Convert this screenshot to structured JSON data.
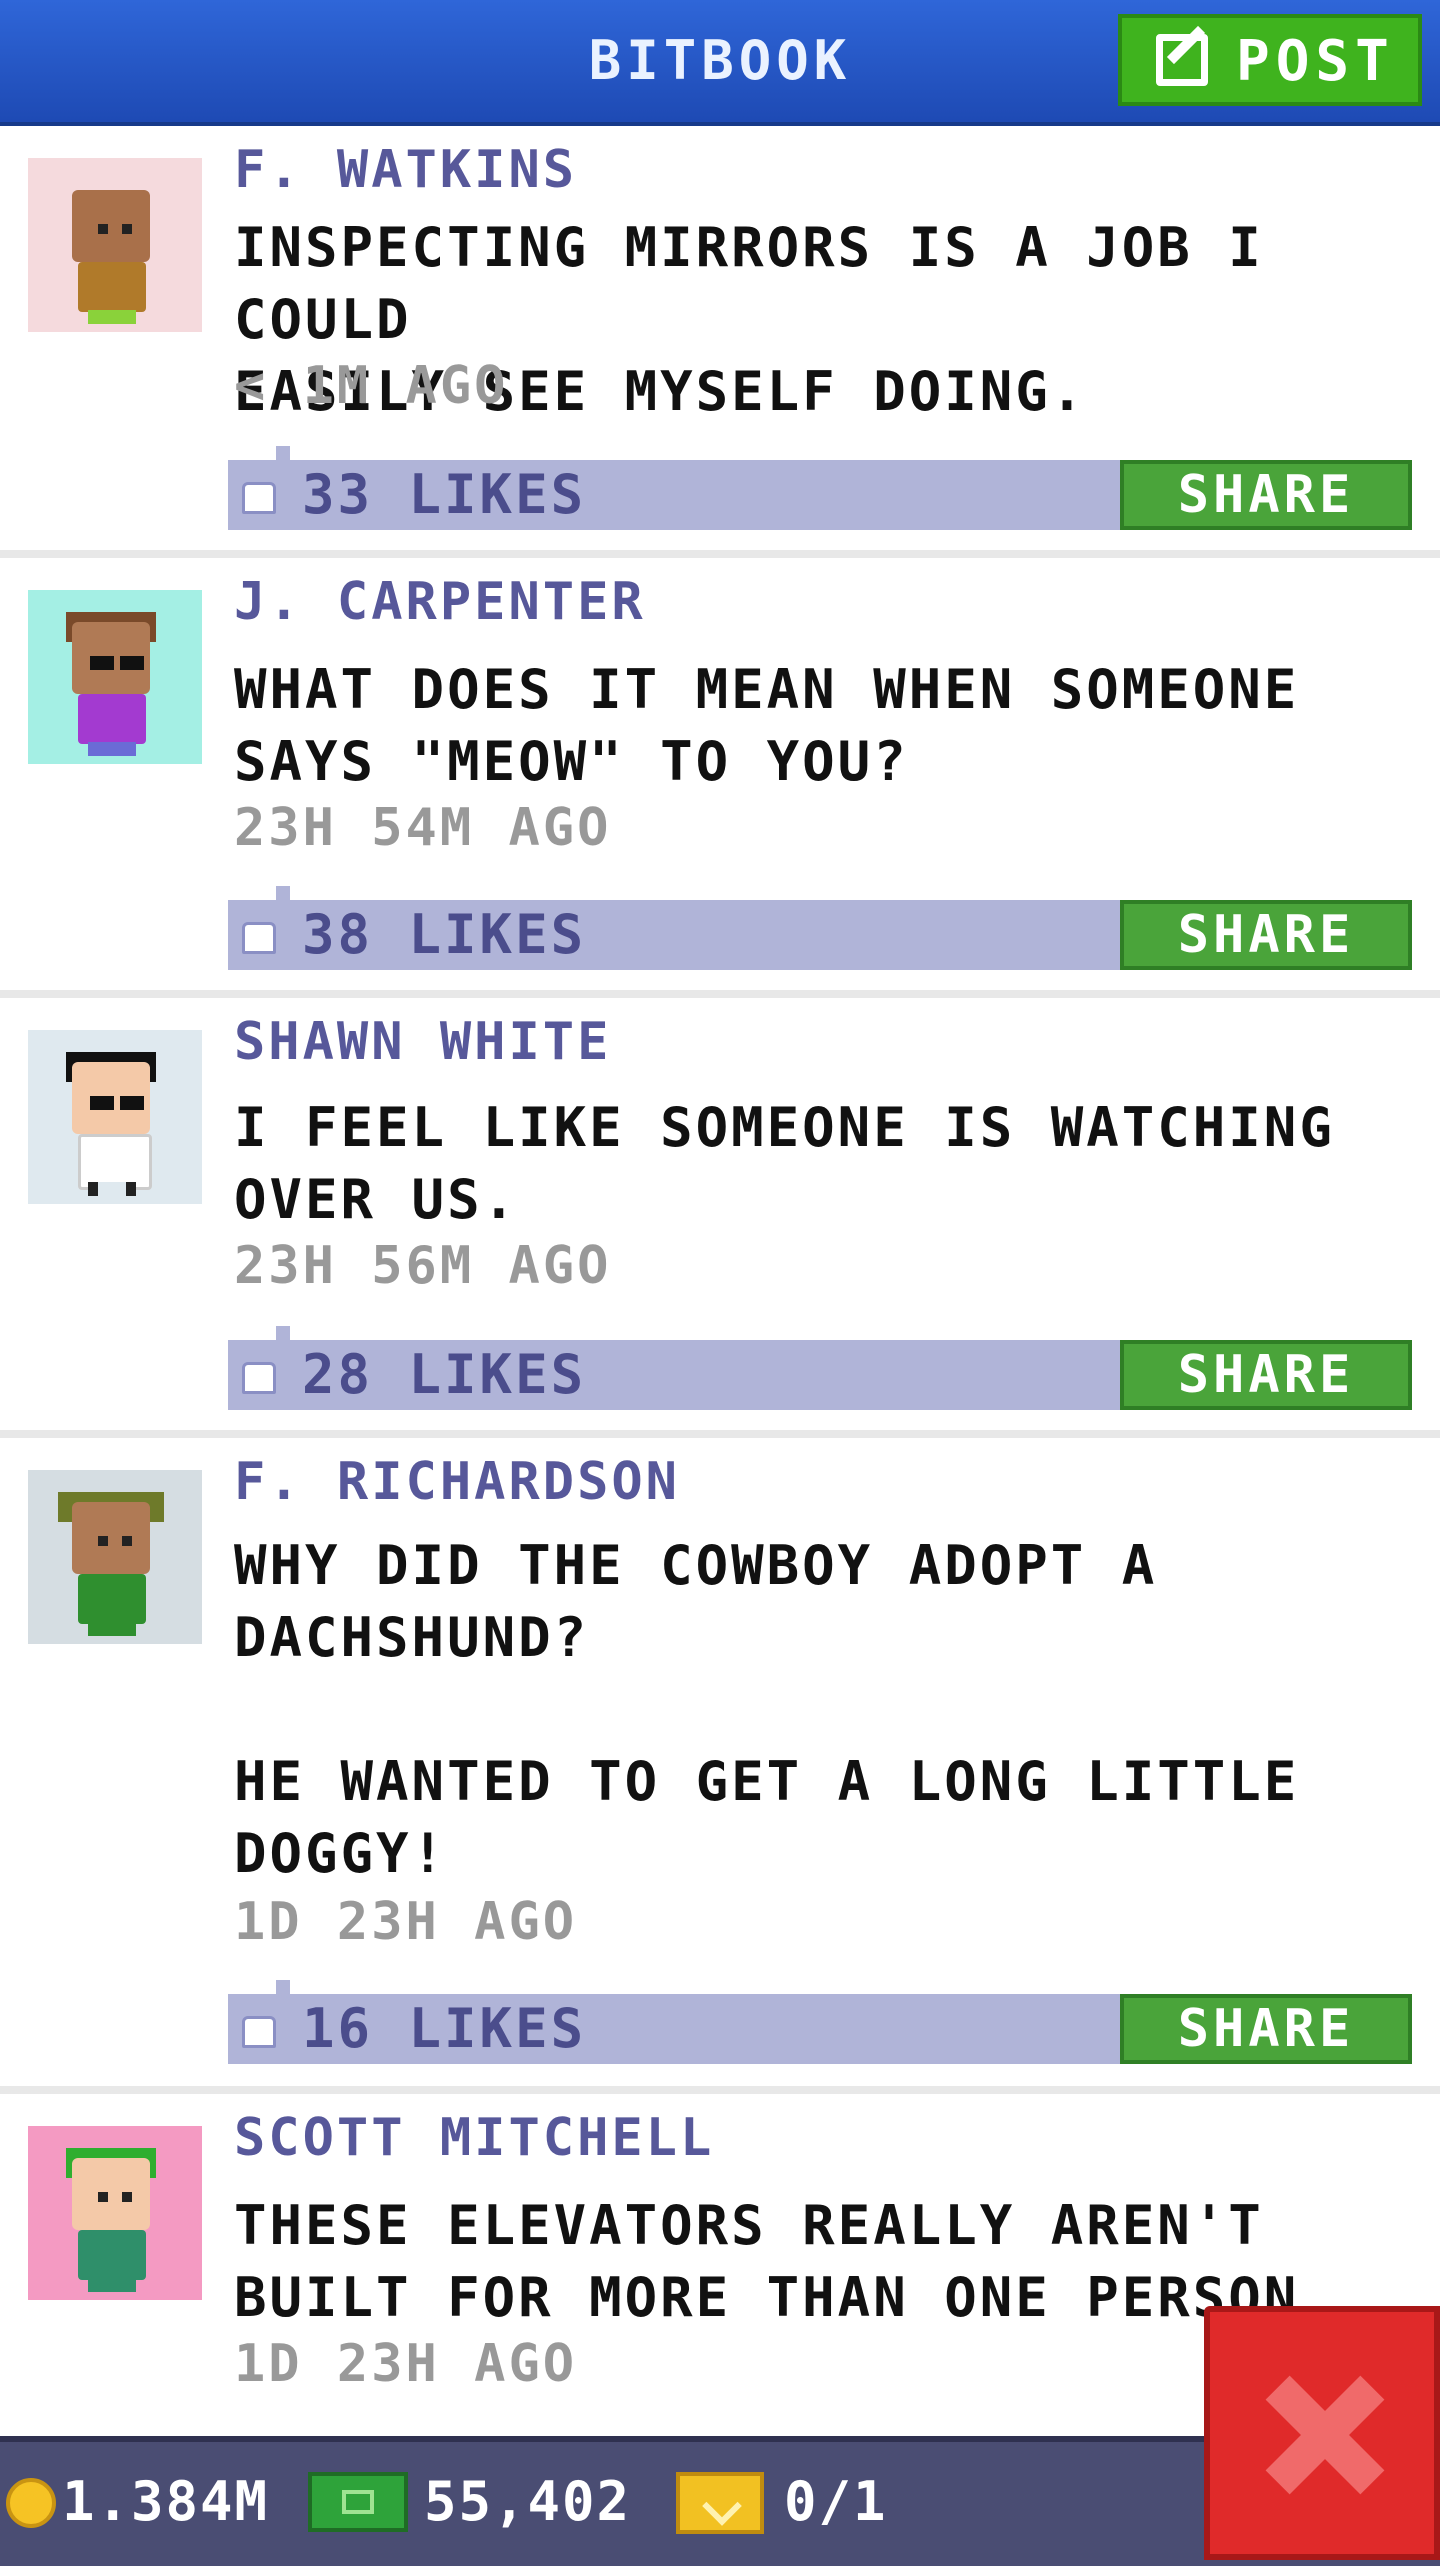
{
  "header": {
    "title": "BITBOOK",
    "post_label": "POST"
  },
  "feed": [
    {
      "author": "F. WATKINS",
      "text": "INSPECTING MIRRORS IS A JOB I COULD\nEASILY SEE MYSELF DOING.",
      "time": "< 1M AGO",
      "likes": "33 LIKES",
      "share": "SHARE",
      "avatar_bg": "#f5dadd"
    },
    {
      "author": "J. CARPENTER",
      "text": "WHAT DOES IT MEAN WHEN SOMEONE\nSAYS \"MEOW\" TO YOU?",
      "time": "23H 54M AGO",
      "likes": "38 LIKES",
      "share": "SHARE",
      "avatar_bg": "#a4efe4"
    },
    {
      "author": "SHAWN WHITE",
      "text": "I FEEL LIKE SOMEONE IS WATCHING\nOVER US.",
      "time": "23H 56M AGO",
      "likes": "28 LIKES",
      "share": "SHARE",
      "avatar_bg": "#dfe9ef"
    },
    {
      "author": "F. RICHARDSON",
      "text": "WHY DID THE COWBOY ADOPT A\nDACHSHUND?\n\nHE WANTED TO GET A LONG LITTLE\nDOGGY!",
      "time": "1D 23H AGO",
      "likes": "16 LIKES",
      "share": "SHARE",
      "avatar_bg": "#d5dde2"
    },
    {
      "author": "SCOTT MITCHELL",
      "text": "THESE ELEVATORS REALLY AREN'T\nBUILT FOR MORE THAN ONE PERSON.",
      "time": "1D 23H AGO",
      "avatar_bg": "#f49ac2"
    }
  ],
  "footer": {
    "coins": "1.384M",
    "bux": "55,402",
    "tickets": "0/1"
  },
  "icons": {
    "post": "compose-icon",
    "like": "thumbs-up-icon",
    "coin": "coin-icon",
    "cash": "cash-icon",
    "ticket": "ticket-icon",
    "close": "close-icon"
  },
  "colors": {
    "header": "#2f66d8",
    "post_button": "#3fb31e",
    "share_button": "#4aa43a",
    "likes_bar": "#b0b4d8",
    "author_text": "#57589a",
    "footer": "#4a4d73",
    "close_button": "#e02a2a"
  }
}
